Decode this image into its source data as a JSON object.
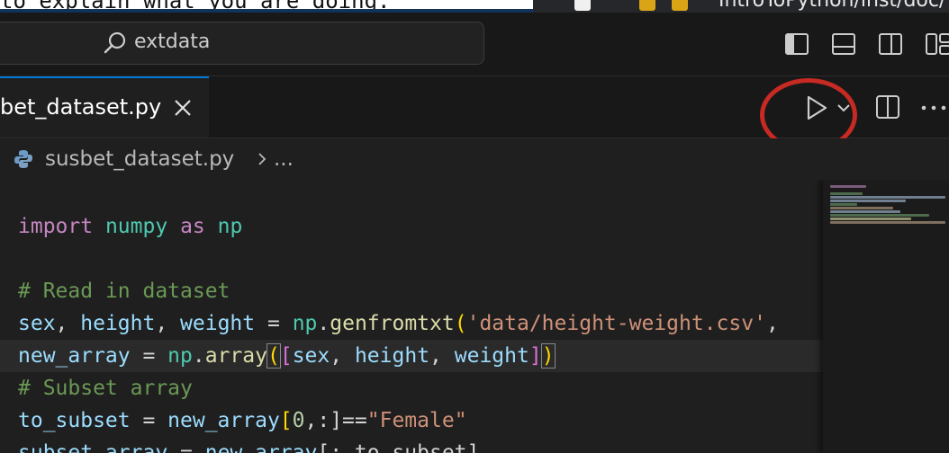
{
  "background_text": {
    "left": "to explain what you are doing.",
    "right_path": "IntroToPython/inst/doc/"
  },
  "titlebar": {
    "search": {
      "text": "extdata",
      "icon": "search-icon"
    },
    "layout_buttons": [
      "toggle-primary-sidebar-icon",
      "toggle-panel-icon",
      "toggle-secondary-sidebar-icon",
      "customize-layout-icon"
    ]
  },
  "tabs": [
    {
      "label": "susbet_dataset.py",
      "visible_label": "bet_dataset.py",
      "active": true,
      "close_icon": "close-icon"
    }
  ],
  "editor_actions": {
    "run": "play-icon",
    "run_dropdown": "chevron-down-icon",
    "split": "split-editor-icon",
    "more": "ellipsis-icon"
  },
  "annotation": {
    "shape": "circle",
    "color": "#c62a22",
    "target": "run-button"
  },
  "breadcrumb": {
    "file": "susbet_dataset.py",
    "more": "..."
  },
  "colors": {
    "editor_bg": "#1f1f1f",
    "keyword": "#c586c0",
    "module": "#4ec9b0",
    "variable": "#9cdcfe",
    "function": "#dcdcaa",
    "string": "#ce9178",
    "comment": "#6a9955",
    "accent": "#0078d4"
  },
  "code": {
    "l1": {
      "kw1": "import",
      "mod1": "numpy",
      "kw2": "as",
      "mod2": "np"
    },
    "l2": {
      "comment": "# Read in dataset"
    },
    "l3": {
      "v1": "sex",
      "v2": "height",
      "v3": "weight",
      "mod": "np",
      "fn": "genfromtxt",
      "str": "'data/height-weight.csv'",
      "tail": ","
    },
    "l4": {
      "v1": "new_array",
      "mod": "np",
      "fn": "array",
      "a1": "sex",
      "a2": "height",
      "a3": "weight"
    },
    "l5": {
      "comment": "# Subset array"
    },
    "l6": {
      "v1": "to_subset",
      "v2": "new_array",
      "num": "0",
      "op": ",:]==",
      "str": "\"Female\""
    },
    "l7": {
      "v1": "subset_array",
      "v2": "new_array",
      "rest": "[:,to_subset]"
    }
  }
}
